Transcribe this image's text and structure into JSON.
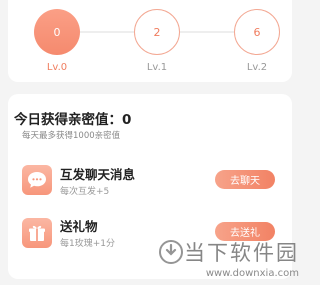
{
  "levels": [
    {
      "value": "0",
      "label": "Lv.0",
      "active": true
    },
    {
      "value": "2",
      "label": "Lv.1",
      "active": false
    },
    {
      "value": "6",
      "label": "Lv.2",
      "active": false
    }
  ],
  "intimacy": {
    "title": "今日获得亲密值：0",
    "subtitle": "每天最多获得1000亲密值"
  },
  "tasks": [
    {
      "icon": "chat-bubble-icon",
      "title": "互发聊天消息",
      "desc": "每次互发+5",
      "button": "去聊天"
    },
    {
      "icon": "gift-icon",
      "title": "送礼物",
      "desc": "每1玫瑰+1分",
      "button": "去送礼"
    }
  ],
  "watermark": {
    "brand": "当下软件园",
    "url": "www.downxia.com"
  },
  "colors": {
    "accent": "#f58a6e",
    "accent_light": "#fbb7a3"
  }
}
